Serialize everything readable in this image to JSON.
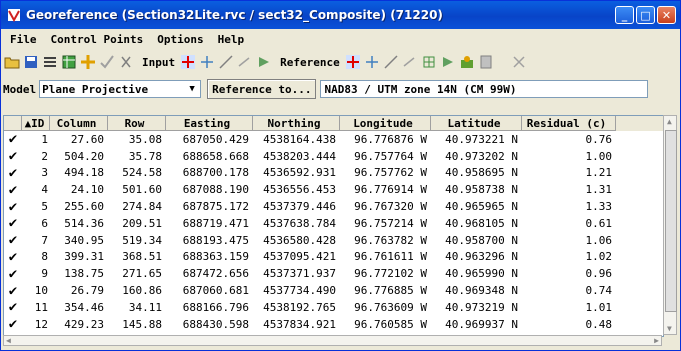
{
  "window": {
    "title": "Georeference (Section32Lite.rvc / sect32_Composite) (71220)"
  },
  "menu": [
    "File",
    "Control Points",
    "Options",
    "Help"
  ],
  "toolbar": {
    "input_label": "Input",
    "reference_label": "Reference"
  },
  "model": {
    "label": "Model",
    "value": "Plane Projective",
    "reference_button": "Reference to...",
    "reference_system": "NAD83 / UTM zone 14N (CM 99W)"
  },
  "table": {
    "headers": [
      "",
      "▲ID",
      "Column",
      "Row",
      "Easting",
      "Northing",
      "Longitude",
      "Latitude",
      "Residual (c)"
    ],
    "rows": [
      [
        "1",
        "27.60",
        "35.08",
        "687050.429",
        "4538164.438",
        "96.776876 W",
        "40.973221 N",
        "0.76"
      ],
      [
        "2",
        "504.20",
        "35.78",
        "688658.668",
        "4538203.444",
        "96.757764 W",
        "40.973202 N",
        "1.00"
      ],
      [
        "3",
        "494.18",
        "524.58",
        "688700.178",
        "4536592.931",
        "96.757762 W",
        "40.958695 N",
        "1.21"
      ],
      [
        "4",
        "24.10",
        "501.60",
        "687088.190",
        "4536556.453",
        "96.776914 W",
        "40.958738 N",
        "1.31"
      ],
      [
        "5",
        "255.60",
        "274.84",
        "687875.172",
        "4537379.446",
        "96.767320 W",
        "40.965965 N",
        "1.33"
      ],
      [
        "6",
        "514.36",
        "209.51",
        "688719.471",
        "4537638.784",
        "96.757214 W",
        "40.968105 N",
        "0.61"
      ],
      [
        "7",
        "340.95",
        "519.34",
        "688193.475",
        "4536580.428",
        "96.763782 W",
        "40.958700 N",
        "1.06"
      ],
      [
        "8",
        "399.31",
        "368.51",
        "688363.159",
        "4537095.421",
        "96.761611 W",
        "40.963296 N",
        "1.02"
      ],
      [
        "9",
        "138.75",
        "271.65",
        "687472.656",
        "4537371.937",
        "96.772102 W",
        "40.965990 N",
        "0.96"
      ],
      [
        "10",
        "26.79",
        "160.86",
        "687060.681",
        "4537734.490",
        "96.776885 W",
        "40.969348 N",
        "0.74"
      ],
      [
        "11",
        "354.46",
        "34.11",
        "688166.796",
        "4538192.765",
        "96.763609 W",
        "40.973219 N",
        "1.01"
      ],
      [
        "12",
        "429.23",
        "145.88",
        "688430.598",
        "4537834.921",
        "96.760585 W",
        "40.969937 N",
        "0.48"
      ]
    ]
  },
  "colors": {
    "titlebar": "#0a5fe0",
    "check": "#000000"
  }
}
